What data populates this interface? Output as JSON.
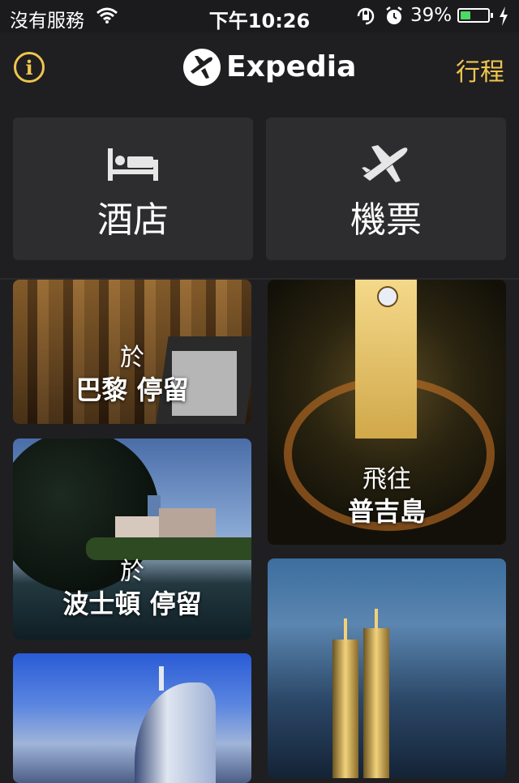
{
  "status_bar": {
    "carrier": "沒有服務",
    "time": "下午10:26",
    "battery_percent": "39%",
    "battery_level": 0.39,
    "battery_color": "#4cd964",
    "icons": [
      "wifi-icon",
      "rotation-lock-icon",
      "alarm-icon",
      "battery-icon",
      "charging-bolt-icon"
    ]
  },
  "header": {
    "logo_text": "Expedia",
    "trips_label": "行程",
    "info_icon": "i",
    "accent_color": "#f0c54e"
  },
  "categories": [
    {
      "label": "酒店",
      "icon": "bed-icon"
    },
    {
      "label": "機票",
      "icon": "airplane-icon"
    }
  ],
  "tiles": [
    {
      "line1": "於",
      "line2": "巴黎 停留"
    },
    {
      "line1": "於",
      "line2": "波士頓 停留"
    },
    {
      "line1": "飛往",
      "line2": "普吉島"
    }
  ]
}
